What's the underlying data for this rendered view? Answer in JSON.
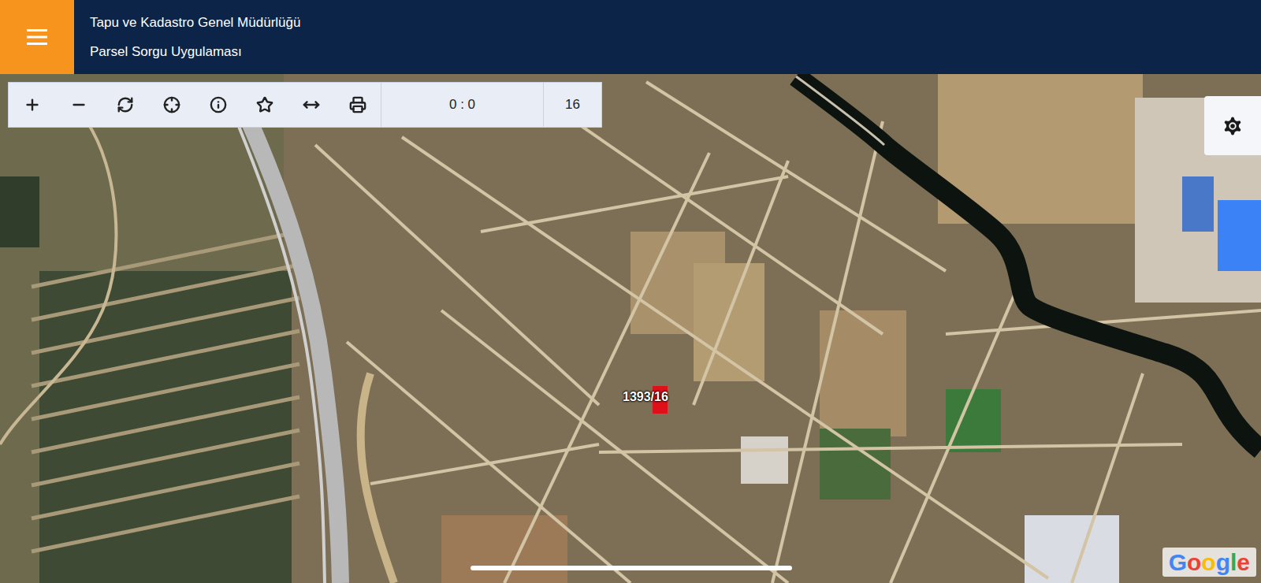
{
  "header": {
    "title": "Tapu ve Kadastro Genel Müdürlüğü",
    "subtitle": "Parsel Sorgu Uygulaması"
  },
  "toolbar": {
    "scale": "0 : 0",
    "zoom": "16"
  },
  "map": {
    "parcel_label": "1393/16",
    "attribution": "Google"
  }
}
